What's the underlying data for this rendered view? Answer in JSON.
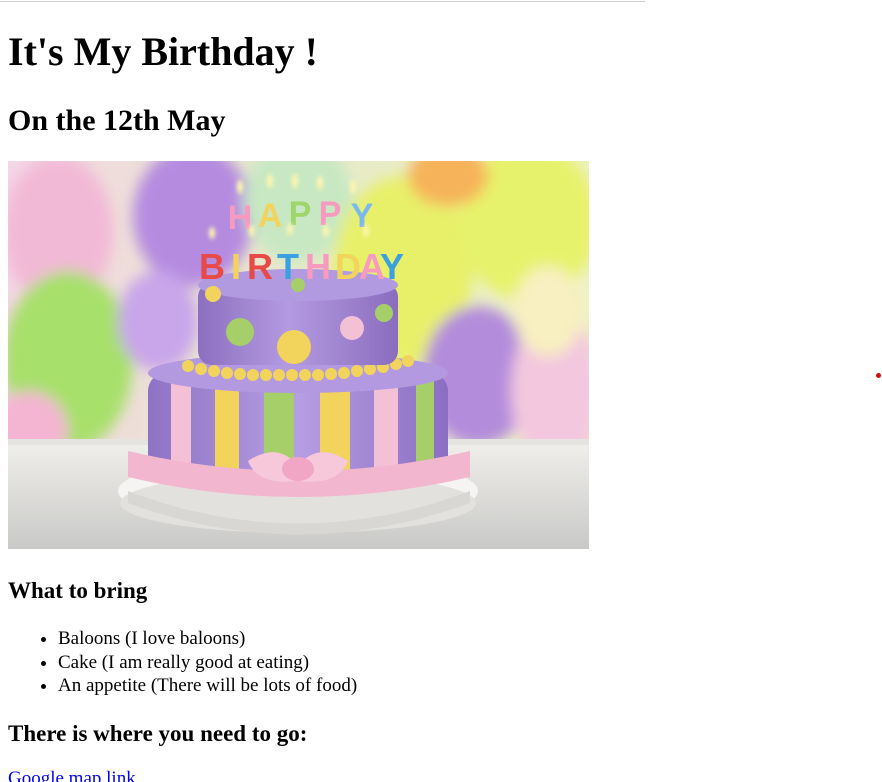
{
  "page": {
    "title": "It's My Birthday !",
    "subtitle": "On the 12th May"
  },
  "photo": {
    "cake_text_top": "HAPPY",
    "cake_text_bottom": "BIRTHDAY",
    "colors": {
      "balloon_yellow": "#e8f06a",
      "balloon_purple": "#b58be0",
      "balloon_green": "#a8e06c",
      "balloon_pink": "#f4a8d0",
      "cake_purple": "#a98bd6",
      "ribbon_pink": "#f3b6cf",
      "stripe_yellow": "#f2d35c",
      "stripe_green": "#a6cf6a"
    }
  },
  "bring": {
    "heading": "What to bring",
    "items": [
      "Baloons (I love baloons)",
      "Cake (I am really good at eating)",
      "An appetite (There will be lots of food)"
    ]
  },
  "location": {
    "heading": "There is where you need to go:",
    "link_text": "Google map link"
  }
}
